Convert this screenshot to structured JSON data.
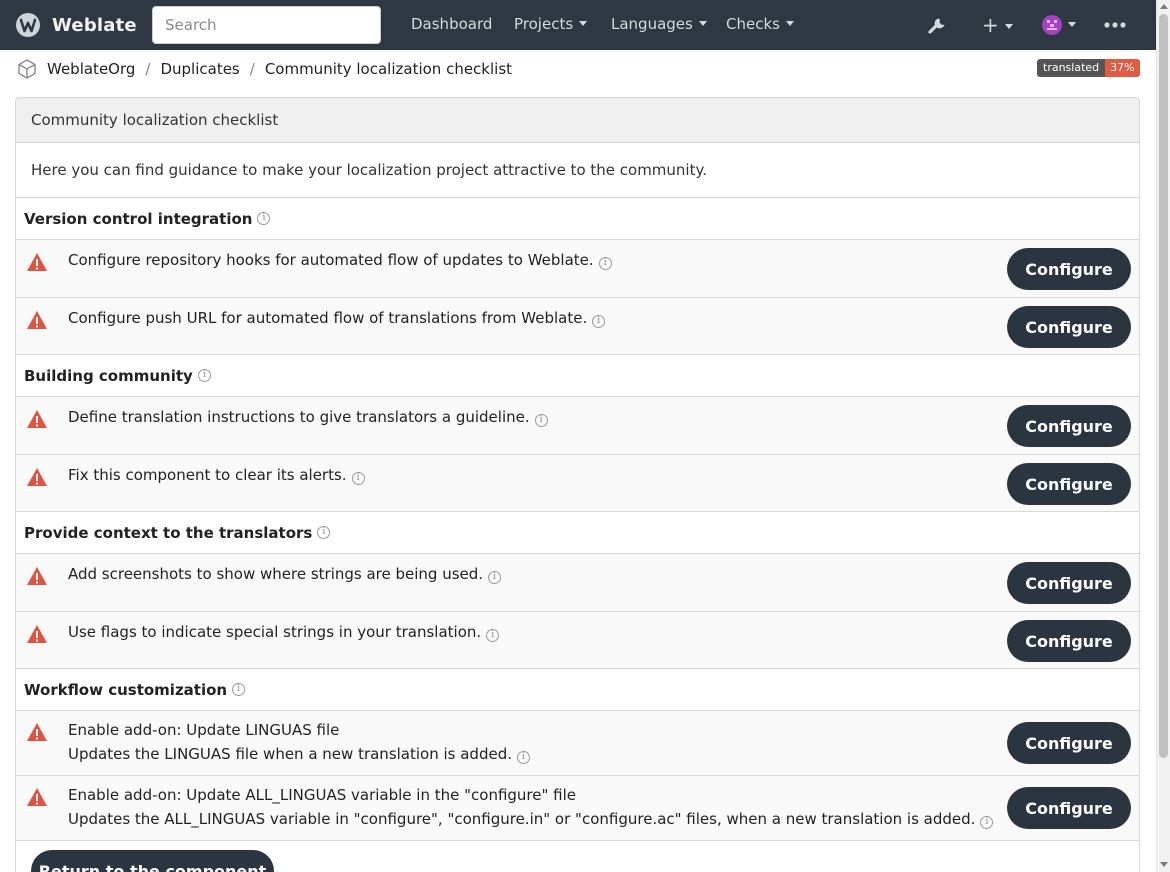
{
  "navbar": {
    "brand": "Weblate",
    "search_placeholder": "Search",
    "menu": [
      "Dashboard",
      "Projects",
      "Languages",
      "Checks"
    ],
    "icons": [
      "wrench-icon",
      "plus-icon",
      "avatar",
      "more-icon"
    ]
  },
  "breadcrumb": {
    "items": [
      "WeblateOrg",
      "Duplicates",
      "Community localization checklist"
    ]
  },
  "badge": {
    "label": "translated",
    "value": "37%"
  },
  "panel": {
    "title": "Community localization checklist",
    "intro": "Here you can find guidance to make your localization project attractive to the community.",
    "button_label": "Configure",
    "return_label": "Return to the component",
    "sections": [
      {
        "title": "Version control integration",
        "items": [
          {
            "text": "Configure repository hooks for automated flow of updates to Weblate."
          },
          {
            "text": "Configure push URL for automated flow of translations from Weblate."
          }
        ]
      },
      {
        "title": "Building community",
        "items": [
          {
            "text": "Define translation instructions to give translators a guideline."
          },
          {
            "text": "Fix this component to clear its alerts."
          }
        ]
      },
      {
        "title": "Provide context to the translators",
        "items": [
          {
            "text": "Add screenshots to show where strings are being used."
          },
          {
            "text": "Use flags to indicate special strings in your translation."
          }
        ]
      },
      {
        "title": "Workflow customization",
        "items": [
          {
            "text": "Enable add-on: Update LINGUAS file",
            "subtext": "Updates the LINGUAS file when a new translation is added."
          },
          {
            "text": "Enable add-on: Update ALL_LINGUAS variable in the \"configure\" file",
            "subtext": "Updates the ALL_LINGUAS variable in \"configure\", \"configure.in\" or \"configure.ac\" files, when a new translation is added."
          }
        ]
      }
    ]
  },
  "colors": {
    "navbar": "#2d3842",
    "button": "#2b3540",
    "warning": "#e0533e",
    "badge_value": "#e05d44"
  }
}
